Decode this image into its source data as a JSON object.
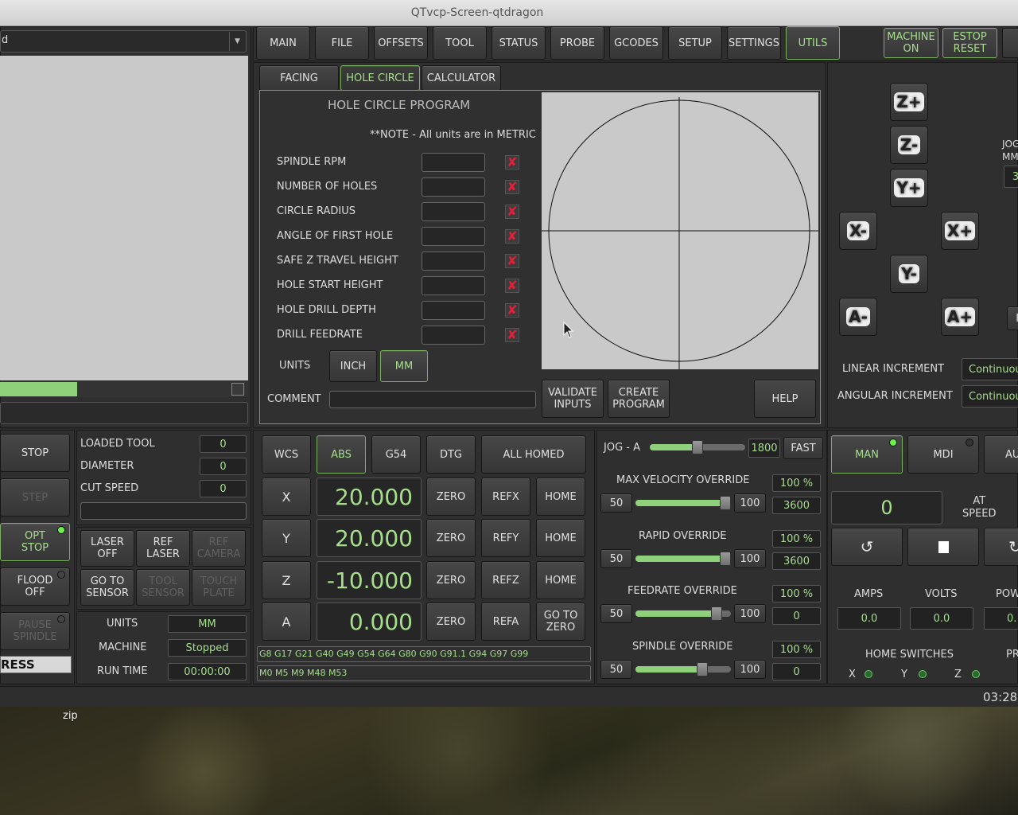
{
  "window": {
    "title": "QTvcp-Screen-qtdragon"
  },
  "top_tabs": [
    "MAIN",
    "FILE",
    "OFFSETS",
    "TOOL",
    "STATUS",
    "PROBE",
    "GCODES",
    "SETUP",
    "SETTINGS",
    "UTILS"
  ],
  "top_right": {
    "machine_on": "MACHINE\nON",
    "estop_reset": "ESTOP\nRESET"
  },
  "file_combo": {
    "value": "d"
  },
  "sub_tabs": [
    "FACING",
    "HOLE CIRCLE",
    "CALCULATOR"
  ],
  "hole_circle": {
    "title": "HOLE CIRCLE PROGRAM",
    "note": "**NOTE - All units are in METRIC",
    "params": [
      "SPINDLE RPM",
      "NUMBER OF HOLES",
      "CIRCLE RADIUS",
      "ANGLE OF FIRST HOLE",
      "SAFE Z TRAVEL HEIGHT",
      "HOLE START HEIGHT",
      "HOLE DRILL DEPTH",
      "DRILL FEEDRATE"
    ],
    "units_label": "UNITS",
    "inch": "INCH",
    "mm": "MM",
    "comment_label": "COMMENT",
    "validate": "VALIDATE\nINPUTS",
    "create": "CREATE\nPROGRAM",
    "help": "HELP"
  },
  "jog": {
    "labels": {
      "zp": "Z+",
      "zm": "Z-",
      "yp": "Y+",
      "ym": "Y-",
      "xm": "X-",
      "xp": "X+",
      "am": "A-",
      "ap": "A+"
    },
    "jog_label": "JOG\nMM",
    "linear_increment": "LINEAR INCREMENT",
    "angular_increment": "ANGULAR INCREMENT",
    "linear_value": "Continuous",
    "angular_value": "Continuous",
    "side_btn": "F",
    "jog_mm_value": "3"
  },
  "left_buttons": {
    "stop": "STOP",
    "step": "STEP",
    "opt_stop": "OPT\nSTOP",
    "flood": "FLOOD\nOFF",
    "pause": "PAUSE\nSPINDLE",
    "progress": "RESS"
  },
  "tool_info": {
    "loaded_tool_label": "LOADED TOOL",
    "loaded_tool": "0",
    "diameter_label": "DIAMETER",
    "diameter": "0",
    "cut_speed_label": "CUT SPEED",
    "cut_speed": "0"
  },
  "laser": {
    "laser_off": "LASER\nOFF",
    "ref_laser": "REF\nLASER",
    "ref_camera": "REF\nCAMERA",
    "go_to_sensor": "GO TO\nSENSOR",
    "tool_sensor": "TOOL\nSENSOR",
    "touch_plate": "TOUCH\nPLATE"
  },
  "status": {
    "units_label": "UNITS",
    "units": "MM",
    "machine_label": "MACHINE",
    "machine": "Stopped",
    "runtime_label": "RUN TIME",
    "runtime": "00:00:00"
  },
  "dro": {
    "wcs": "WCS",
    "abs": "ABS",
    "g54": "G54",
    "dtg": "DTG",
    "all_homed": "ALL HOMED",
    "axes": [
      {
        "name": "X",
        "value": "20.000",
        "ref": "REFX",
        "home": "HOME"
      },
      {
        "name": "Y",
        "value": "20.000",
        "ref": "REFY",
        "home": "HOME"
      },
      {
        "name": "Z",
        "value": "-10.000",
        "ref": "REFZ",
        "home": "HOME"
      },
      {
        "name": "A",
        "value": "0.000",
        "ref": "REFA",
        "home": "GO TO\nZERO"
      }
    ],
    "zero": "ZERO",
    "gcodes": "G8 G17 G21 G40 G49 G54 G64 G80 G90 G91.1 G94 G97 G99",
    "mcodes": "M0 M5 M9 M48 M53"
  },
  "overrides": {
    "jog_label": "JOG - A",
    "jog_value": "1800",
    "fast": "FAST",
    "jog_level": 0.5,
    "items": [
      {
        "label": "MAX VELOCITY OVERRIDE",
        "pct": "100 %",
        "min": "50",
        "max": "100",
        "value": "3600",
        "level": 1.0
      },
      {
        "label": "RAPID OVERRIDE",
        "pct": "100 %",
        "min": "50",
        "max": "100",
        "value": "3600",
        "level": 1.0
      },
      {
        "label": "FEEDRATE OVERRIDE",
        "pct": "100 %",
        "min": "50",
        "max": "100",
        "value": "0",
        "level": 0.85
      },
      {
        "label": "SPINDLE OVERRIDE",
        "pct": "100 %",
        "min": "50",
        "max": "100",
        "value": "0",
        "level": 0.7
      }
    ]
  },
  "spindle": {
    "man": "MAN",
    "mdi": "MDI",
    "auto": "AU",
    "rpm": "0",
    "at_speed": "AT\nSPEED",
    "amps_label": "AMPS",
    "amps": "0.0",
    "volts_label": "VOLTS",
    "volts": "0.0",
    "power_label": "POW",
    "power": "0.",
    "home_switches": "HOME SWITCHES",
    "pr": "PR",
    "x": "X",
    "y": "Y",
    "z": "Z"
  },
  "statusbar": {
    "time": "03:28"
  },
  "desktop": {
    "zip_label": "zip"
  }
}
